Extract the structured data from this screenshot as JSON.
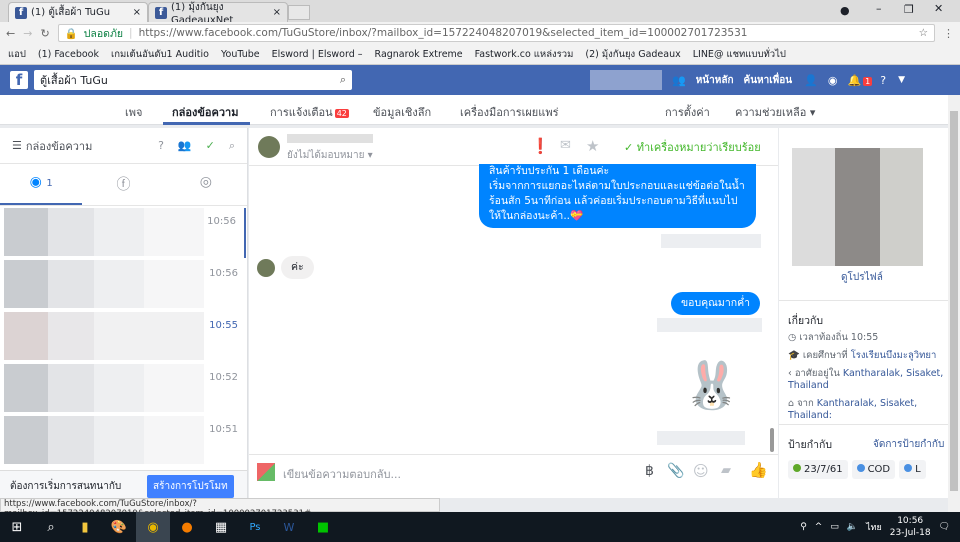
{
  "browser": {
    "tabs": [
      {
        "title": "(1) ตู้เสื้อผ้า TuGu",
        "active": true
      },
      {
        "title": "(1) มุ้งกันยุง GadeauxNet",
        "active": false
      }
    ],
    "secure_label": "ปลอดภัย",
    "url": "https://www.facebook.com/TuGuStore/inbox/?mailbox_id=157224048207019&selected_item_id=100002701723531",
    "bookmarks": [
      "แอป",
      "(1) Facebook",
      "เกมเต้นอันดับ1 Auditio",
      "YouTube",
      "Elsword | Elsword – ",
      "Ragnarok Extreme",
      "Fastwork.co แหล่งรวม",
      "(2) มุ้งกันยุง Gadeaux",
      "LINE@ แชทแบบทั่วไป"
    ],
    "status_url": "https://www.facebook.com/TuGuStore/inbox/?mailbox_id=157224048207019&selected_item_id=100002701723531#"
  },
  "fb_header": {
    "search_value": "ตู้เสื้อผ้า TuGu",
    "home": "หน้าหลัก",
    "find_friends": "ค้นหาเพื่อน",
    "notif_count": "1"
  },
  "page_nav": {
    "items": [
      "เพจ",
      "กล่องข้อความ",
      "การแจ้งเตือน",
      "ข้อมูลเชิงลึก",
      "เครื่องมือการเผยแพร่"
    ],
    "notif_badge": "42",
    "settings": "การตั้งค่า",
    "help": "ความช่วยเหลือ ▾",
    "active": "กล่องข้อความ"
  },
  "inbox": {
    "title": "กล่องข้อความ",
    "messenger_count": "1",
    "times": [
      "10:56",
      "10:56",
      "10:55",
      "10:52",
      "10:51"
    ],
    "promo_text": "ต้องการเริ่มการสนทนากับ",
    "promo_button": "สร้างการโปรโมท"
  },
  "conversation": {
    "assign_label": "ยังไม่ได้มอบหมาย ▾",
    "done_label": "ทำเครื่องหมายว่าเรียบร้อย",
    "messages": [
      {
        "from": "page",
        "text": "สินค้ารับประกัน 1 เดือนค่ะ\nเริ่มจากการแยกอะไหล่ตามใบประกอบและแช่ข้อต่อในน้ำร้อนสัก 5นาทีก่อน แล้วค่อยเริ่มประกอบตามวิธีที่แนบไปให้ในกล่องนะค้า..💝"
      },
      {
        "from": "customer",
        "text": "ค่ะ"
      },
      {
        "from": "page",
        "text": "ขอบคุณมากค่ำ"
      },
      {
        "from": "page",
        "type": "sticker"
      }
    ],
    "composer_placeholder": "เขียนข้อความตอบกลับ..."
  },
  "profile": {
    "view_profile": "ดูโปรไฟล์",
    "about_title": "เกี่ยวกับ",
    "local_time": "เวลาท้องถิ่น 10:55",
    "studied_prefix": "เคยศึกษาที่ ",
    "studied": "โรงเรียนบึงมะลูวิทยา",
    "lives_prefix": "อาศัยอยู่ใน ",
    "lives": "Kantharalak, Sisaket, Thailand",
    "from_prefix": "จาก ",
    "from": "Kantharalak, Sisaket, Thailand:",
    "tags_title": "ป้ายกำกับ",
    "manage_tags": "จัดการป้ายกำกับ",
    "tags": [
      {
        "label": "23/7/61",
        "color": "#5fa829"
      },
      {
        "label": "COD",
        "color": "#4a90e2"
      },
      {
        "label": "L",
        "color": "#4a90e2"
      }
    ]
  },
  "taskbar": {
    "time": "10:56",
    "date": "23-Jul-18",
    "lang": "ไทย"
  }
}
